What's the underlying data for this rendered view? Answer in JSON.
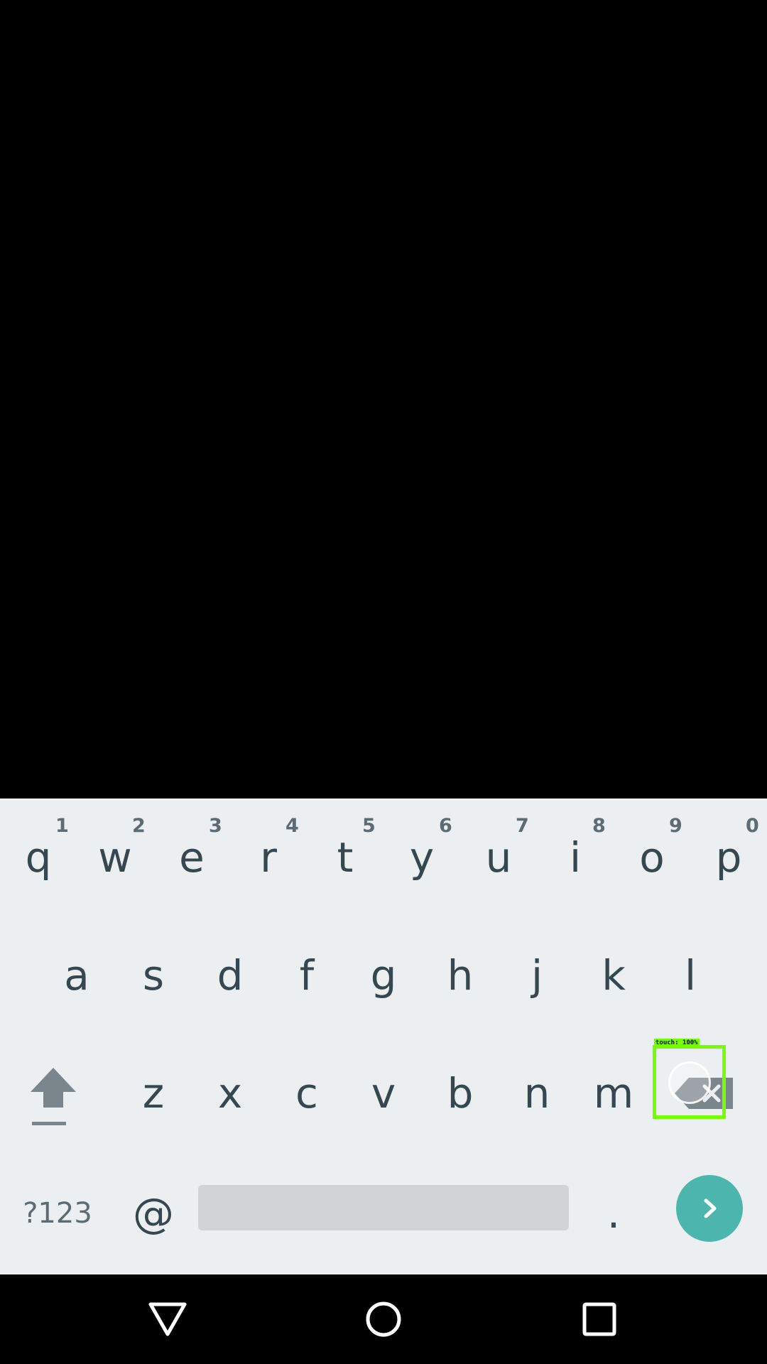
{
  "keyboard": {
    "row1": [
      {
        "key": "q",
        "hint": "1"
      },
      {
        "key": "w",
        "hint": "2"
      },
      {
        "key": "e",
        "hint": "3"
      },
      {
        "key": "r",
        "hint": "4"
      },
      {
        "key": "t",
        "hint": "5"
      },
      {
        "key": "y",
        "hint": "6"
      },
      {
        "key": "u",
        "hint": "7"
      },
      {
        "key": "i",
        "hint": "8"
      },
      {
        "key": "o",
        "hint": "9"
      },
      {
        "key": "p",
        "hint": "0"
      }
    ],
    "row2": [
      "a",
      "s",
      "d",
      "f",
      "g",
      "h",
      "j",
      "k",
      "l"
    ],
    "row3": [
      "z",
      "x",
      "c",
      "v",
      "b",
      "n",
      "m"
    ],
    "symbols_label": "?123",
    "at_label": "@",
    "period_label": ".",
    "shift_icon": "shift-arrow-up-icon",
    "backspace_icon": "backspace-icon",
    "enter_icon": "chevron-right-icon",
    "colors": {
      "background": "#eceff1",
      "key_text": "#37474f",
      "hint_text": "#5f6b72",
      "spacebar": "#d0d4d7",
      "enter": "#4db6ac"
    }
  },
  "touch_overlay": {
    "label": "touch: 100%",
    "color": "#76ff03"
  },
  "nav_bar": {
    "back_icon": "back-triangle-icon",
    "home_icon": "home-circle-icon",
    "recents_icon": "recents-square-icon"
  }
}
